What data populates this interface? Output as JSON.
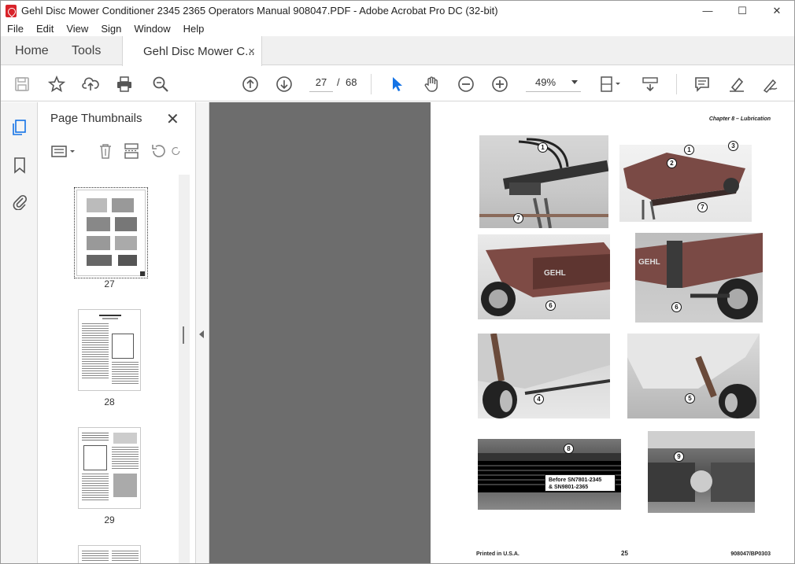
{
  "window": {
    "title": "Gehl Disc Mower Conditioner 2345 2365 Operators Manual 908047.PDF - Adobe Acrobat Pro DC (32-bit)",
    "controls": [
      "—",
      "☐",
      "✕"
    ]
  },
  "menu": [
    "File",
    "Edit",
    "View",
    "Sign",
    "Window",
    "Help"
  ],
  "tabs": {
    "home": "Home",
    "tools": "Tools",
    "doc": "Gehl Disc Mower C...",
    "close": "×"
  },
  "toolbar": {
    "icons": [
      "save-icon",
      "bookmark-star-icon",
      "upload-icon",
      "print-icon",
      "zoom-search-icon",
      "prev-page-icon",
      "next-page-icon",
      "select-pointer-icon",
      "hand-icon",
      "zoom-out-icon",
      "zoom-in-icon",
      "page-fit-icon",
      "scroll-mode-icon",
      "comment-icon",
      "highlight-icon",
      "sign-icon"
    ],
    "page_current": "27",
    "page_separator": "/",
    "page_total": "68",
    "zoom_value": "49%",
    "accent_color": "#1473e6"
  },
  "panel": {
    "title": "Page Thumbnails",
    "close": "✕",
    "thumbnails": [
      {
        "label": "27"
      },
      {
        "label": "28"
      },
      {
        "label": "29"
      }
    ]
  },
  "document": {
    "chapter_header": "Chapter 8 – Lubrication",
    "note": "Before SN7801-2345\n& SN9801-2365",
    "footer_left": "Printed in U.S.A.",
    "footer_page": "25",
    "footer_right": "908047/BP0303",
    "callouts": [
      "1",
      "7",
      "1",
      "2",
      "3",
      "7",
      "6",
      "6",
      "4",
      "5",
      "8",
      "9"
    ]
  }
}
